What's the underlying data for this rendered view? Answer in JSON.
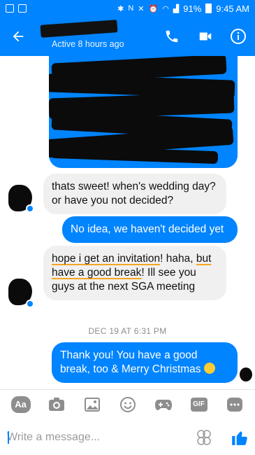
{
  "status_bar": {
    "battery": "91%",
    "time": "9:45 AM"
  },
  "header": {
    "active_status": "Active 8 hours ago"
  },
  "messages": [
    {
      "text": "thats sweet! when's wedding day? or have you not decided?"
    },
    {
      "text": "No idea, we haven't decided yet"
    },
    {
      "text_part1": "hope i get an invitation",
      "text_part2": "! haha, ",
      "text_part3": "but have a good break",
      "text_part4": "! Ill see you guys at the next SGA meeting"
    },
    {
      "text": "Thank you! You have a good break, too & Merry Christmas"
    }
  ],
  "timestamp": "DEC 19 AT 6:31 PM",
  "toolbar": {
    "aa_label": "Aa",
    "gif_label": "GIF"
  },
  "composer": {
    "placeholder": "Write a message..."
  },
  "colors": {
    "brand": "#0084ff",
    "incoming_bubble": "#f1f0f0",
    "underline": "#f5a623"
  }
}
